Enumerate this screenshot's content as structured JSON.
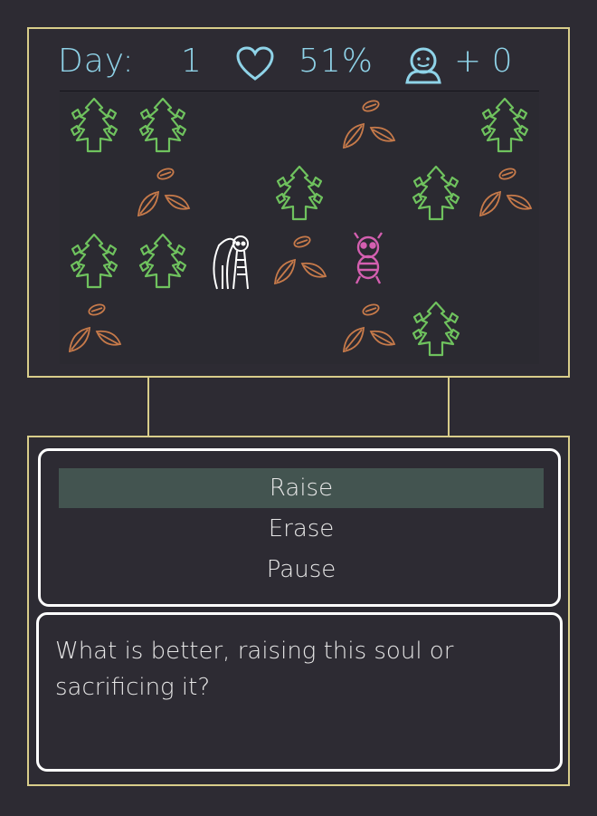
{
  "hud": {
    "day_label": "Day:",
    "day_value": "1",
    "heart_icon": "heart-outline-icon",
    "health_percent": "51%",
    "soul_icon": "soul-face-icon",
    "souls_count": "+ 0",
    "color": "#8fd3e8"
  },
  "grid": {
    "rows": 4,
    "cols": 7,
    "cells": [
      [
        "tree",
        "tree",
        "empty",
        "empty",
        "leaves",
        "empty",
        "tree"
      ],
      [
        "empty",
        "leaves",
        "empty",
        "tree",
        "empty",
        "tree",
        "leaves"
      ],
      [
        "tree",
        "tree",
        "skeleton",
        "leaves",
        "critter",
        "empty",
        "empty"
      ],
      [
        "leaves",
        "empty",
        "empty",
        "empty",
        "leaves",
        "tree",
        "empty"
      ]
    ],
    "colors": {
      "tree": "#6fc25e",
      "leaves": "#c77a4a",
      "skeleton": "#ffffff",
      "critter": "#d45fb0"
    }
  },
  "menu": {
    "items": [
      {
        "label": "Raise",
        "selected": true
      },
      {
        "label": "Erase",
        "selected": false
      },
      {
        "label": "Pause",
        "selected": false
      }
    ]
  },
  "dialog": {
    "text": "What is better, raising this soul or sacrificing it?"
  },
  "colors": {
    "background": "#2d2b33",
    "panel_border": "#d8cd8a",
    "menu_highlight": "#435450"
  }
}
